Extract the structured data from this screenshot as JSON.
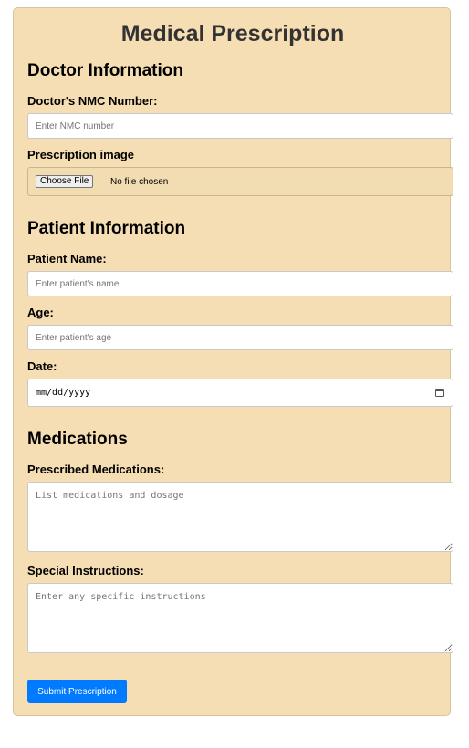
{
  "form": {
    "title": "Medical Prescription",
    "doctor_section": {
      "heading": "Doctor Information",
      "nmc_label": "Doctor's NMC Number:",
      "nmc_placeholder": "Enter NMC number",
      "image_label": "Prescription image",
      "file_button": "Choose File",
      "file_status": "No file chosen"
    },
    "patient_section": {
      "heading": "Patient Information",
      "name_label": "Patient Name:",
      "name_placeholder": "Enter patient's name",
      "age_label": "Age:",
      "age_placeholder": "Enter patient's age",
      "date_label": "Date:",
      "date_placeholder": "mm/dd/yyyy",
      "date_icon": "calendar-icon"
    },
    "medications_section": {
      "heading": "Medications",
      "prescribed_label": "Prescribed Medications:",
      "prescribed_placeholder": "List medications and dosage",
      "instructions_label": "Special Instructions:",
      "instructions_placeholder": "Enter any specific instructions"
    },
    "submit_label": "Submit Prescription"
  },
  "colors": {
    "card_background": "#f5deb3",
    "title_text": "#333333",
    "submit_button": "#007bff",
    "page_background": "#ffffff"
  }
}
